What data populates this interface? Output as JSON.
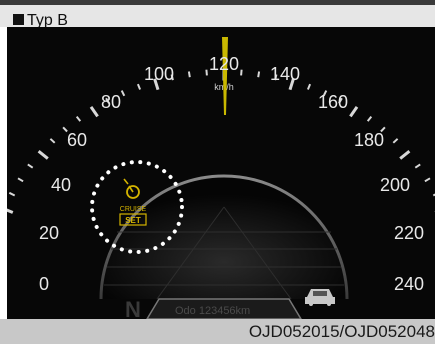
{
  "header": {
    "label": "Typ B"
  },
  "speedometer": {
    "unit": "km/h",
    "speed_labels": [
      "0",
      "20",
      "40",
      "60",
      "80",
      "100",
      "120",
      "140",
      "160",
      "180",
      "200",
      "220",
      "240"
    ],
    "needle_value": 120,
    "needle_color": "#c9b800",
    "odometer": "Odo 123456km",
    "gear": "N"
  },
  "cruise_indicator": {
    "icon": "cruise-speedometer-icon",
    "label": "CRUISE",
    "status": "SET",
    "color": "#d4b400"
  },
  "vehicle_icon": "car-icon",
  "footer": {
    "code": "OJD052015/OJD052048"
  }
}
